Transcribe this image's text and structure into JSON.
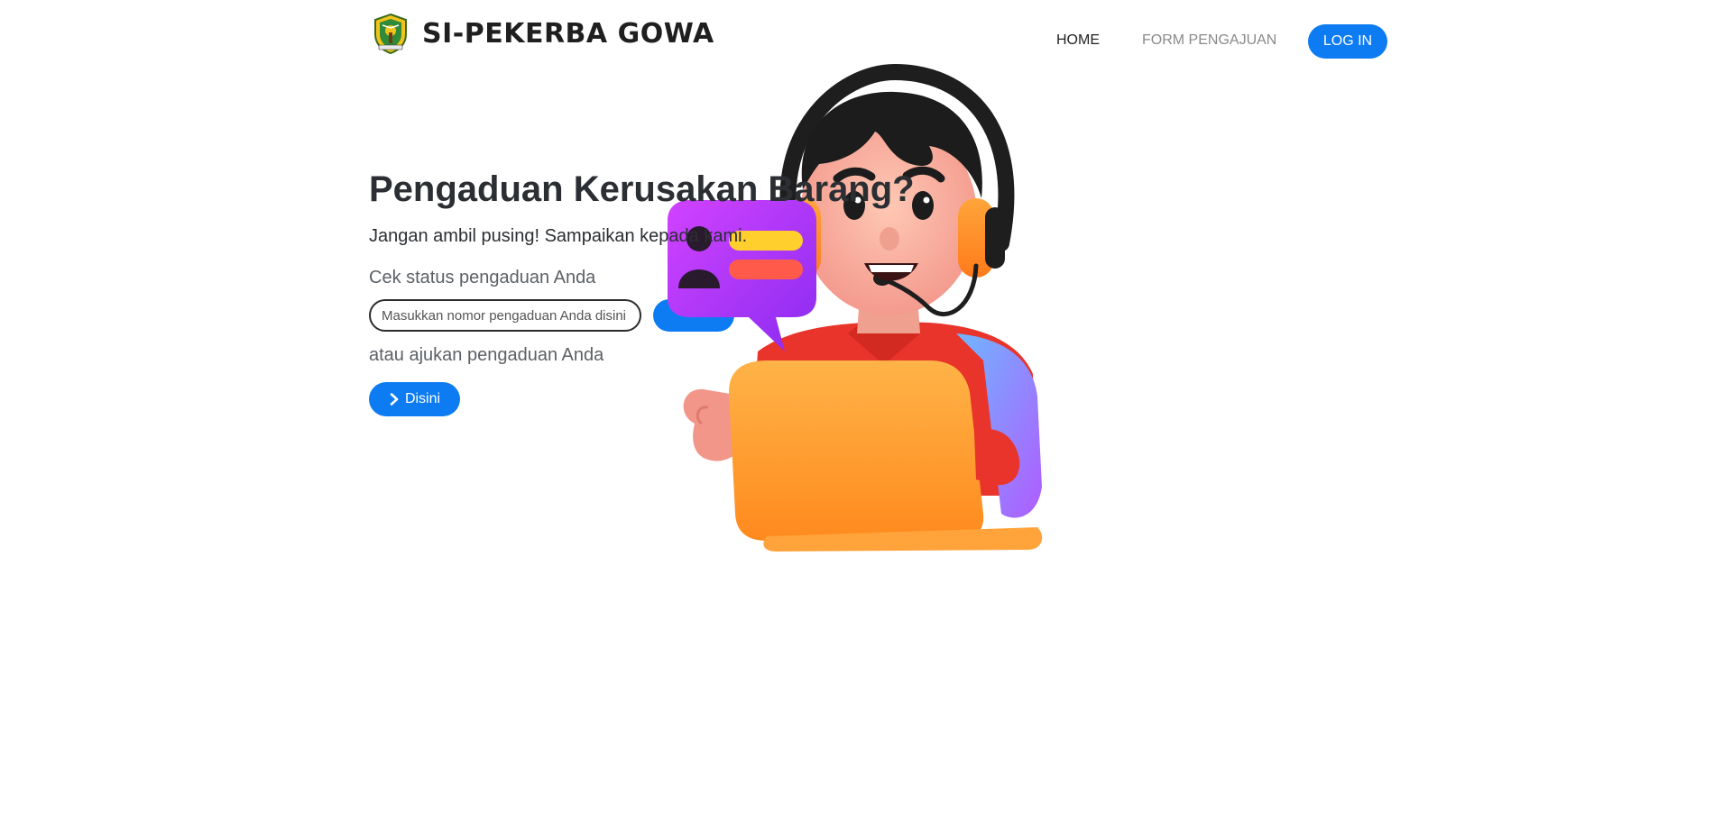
{
  "brand": {
    "name": "SI-PEKERBA GOWA",
    "logo_icon": "gowa-regency-emblem-icon"
  },
  "nav": {
    "items": [
      {
        "label": "HOME",
        "active": true
      },
      {
        "label": "FORM PENGAJUAN",
        "active": false
      }
    ],
    "login_label": "LOG IN"
  },
  "hero": {
    "title": "Pengaduan Kerusakan Barang?",
    "subtitle": "Jangan ambil pusing! Sampaikan kepada kami.",
    "status_label": "Cek status pengaduan Anda",
    "search_placeholder": "Masukkan nomor pengaduan Anda disini",
    "alt_label": "atau ajukan pengaduan Anda",
    "cta_label": "Disini",
    "cta_icon": "chevron-right-icon"
  },
  "illustration": {
    "icon": "customer-support-agent-illustration"
  },
  "colors": {
    "accent": "#0d7cf2",
    "text": "#2b2f33",
    "muted": "#5c6166"
  }
}
